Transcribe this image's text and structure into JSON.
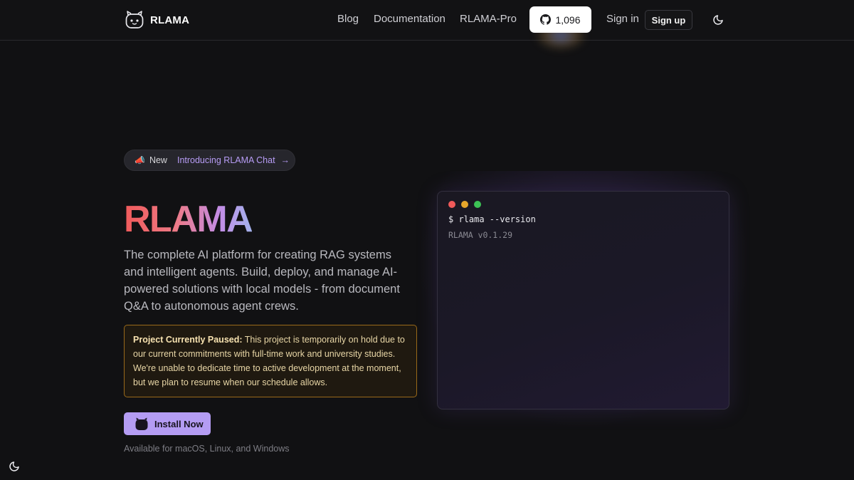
{
  "header": {
    "brand_name": "RLAMA",
    "brand_logo_icon": "robot-face-icon",
    "nav": {
      "blog": "Blog",
      "documentation": "Documentation",
      "pro": "RLAMA-Pro",
      "sign_in": "Sign in"
    },
    "github": {
      "icon": "github-icon",
      "stars": "1,096"
    },
    "sign_up": "Sign up",
    "theme_toggle_icon": "moon-icon"
  },
  "hero": {
    "announcement": {
      "emoji": "📣",
      "badge": "New",
      "text": "Introducing RLAMA Chat",
      "arrow": "→"
    },
    "title": "RLAMA",
    "description": "The complete AI platform for creating RAG systems and intelligent agents. Build, deploy, and manage AI-powered solutions with local models - from document Q&A to autonomous agent crews.",
    "notice": {
      "label": "Project Currently Paused:",
      "text": " This project is temporarily on hold due to our current commitments with full-time work and university studies. We're unable to dedicate time to active development at the moment, but we plan to resume when our schedule allows."
    },
    "install_button": "Install Now",
    "install_icon": "robot-icon",
    "availability": "Available for macOS, Linux, and Windows"
  },
  "terminal": {
    "command": "$ rlama --version",
    "output": "RLAMA v0.1.29"
  },
  "colors": {
    "background": "#111113",
    "accent": "#b49cf3",
    "notice_border": "#9a6a1a",
    "title_gradient": [
      "#f05a5a",
      "#c28de6",
      "#a3b2ec"
    ]
  },
  "floating": {
    "theme_toggle_icon": "moon-icon"
  }
}
